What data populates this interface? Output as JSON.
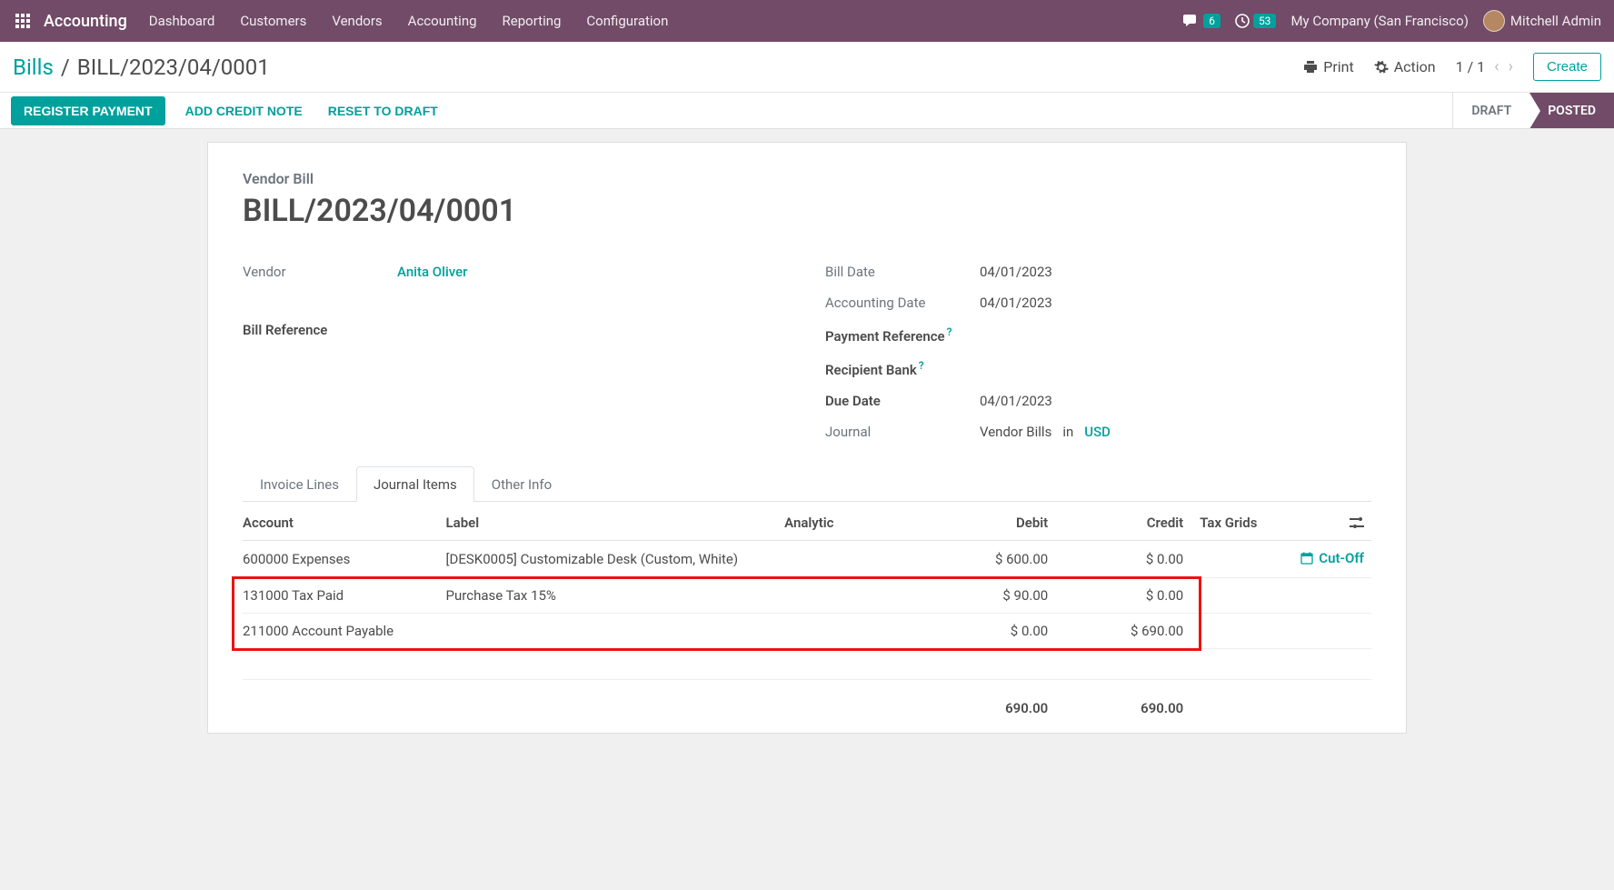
{
  "topnav": {
    "brand": "Accounting",
    "menu": [
      "Dashboard",
      "Customers",
      "Vendors",
      "Accounting",
      "Reporting",
      "Configuration"
    ],
    "discuss_count": "6",
    "activity_count": "53",
    "company": "My Company (San Francisco)",
    "user": "Mitchell Admin"
  },
  "controlbar": {
    "breadcrumb_root": "Bills",
    "breadcrumb_leaf": "BILL/2023/04/0001",
    "print": "Print",
    "action": "Action",
    "pager": "1 / 1",
    "create": "Create"
  },
  "statusbar": {
    "register_payment": "REGISTER PAYMENT",
    "add_credit_note": "ADD CREDIT NOTE",
    "reset_draft": "RESET TO DRAFT",
    "status_draft": "DRAFT",
    "status_posted": "POSTED"
  },
  "doc": {
    "subtitle": "Vendor Bill",
    "title": "BILL/2023/04/0001",
    "fields_left": {
      "vendor_label": "Vendor",
      "vendor_value": "Anita Oliver",
      "bill_ref_label": "Bill Reference",
      "bill_ref_value": ""
    },
    "fields_right": {
      "bill_date_label": "Bill Date",
      "bill_date_value": "04/01/2023",
      "acct_date_label": "Accounting Date",
      "acct_date_value": "04/01/2023",
      "pay_ref_label": "Payment Reference",
      "pay_ref_value": "",
      "recip_bank_label": "Recipient Bank",
      "recip_bank_value": "",
      "due_date_label": "Due Date",
      "due_date_value": "04/01/2023",
      "journal_label": "Journal",
      "journal_value": "Vendor Bills",
      "journal_in": "in",
      "journal_currency": "USD"
    }
  },
  "tabs": {
    "invoice_lines": "Invoice Lines",
    "journal_items": "Journal Items",
    "other_info": "Other Info"
  },
  "table": {
    "headers": {
      "account": "Account",
      "label": "Label",
      "analytic": "Analytic",
      "debit": "Debit",
      "credit": "Credit",
      "tax_grids": "Tax Grids"
    },
    "rows": [
      {
        "account": "600000 Expenses",
        "label": "[DESK0005] Customizable Desk (Custom, White)",
        "analytic": "",
        "debit": "$ 600.00",
        "credit": "$ 0.00",
        "cutoff": "Cut-Off"
      },
      {
        "account": "131000 Tax Paid",
        "label": "Purchase Tax 15%",
        "analytic": "",
        "debit": "$ 90.00",
        "credit": "$ 0.00",
        "cutoff": ""
      },
      {
        "account": "211000 Account Payable",
        "label": "",
        "analytic": "",
        "debit": "$ 0.00",
        "credit": "$ 690.00",
        "cutoff": ""
      }
    ],
    "totals": {
      "debit": "690.00",
      "credit": "690.00"
    }
  }
}
